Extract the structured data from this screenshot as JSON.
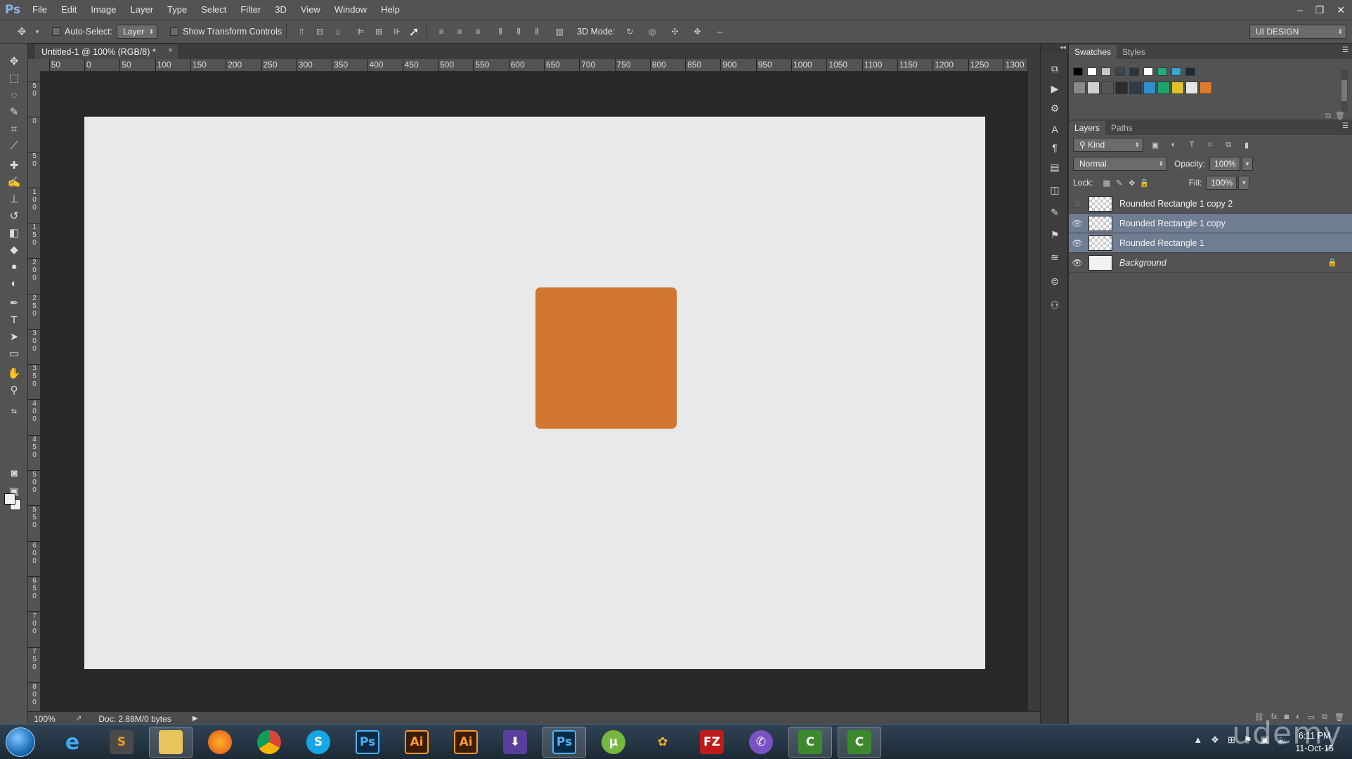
{
  "app": {
    "logo": "Ps"
  },
  "menu": [
    "File",
    "Edit",
    "Image",
    "Layer",
    "Type",
    "Select",
    "Filter",
    "3D",
    "View",
    "Window",
    "Help"
  ],
  "window_controls": {
    "minimize": "–",
    "restore": "❐",
    "close": "✕"
  },
  "options": {
    "auto_select_label": "Auto-Select:",
    "auto_select_value": "Layer",
    "show_transform_label": "Show Transform Controls",
    "mode_3d_label": "3D Mode:",
    "workspace": "UI DESIGN"
  },
  "document": {
    "tab_title": "Untitled-1 @ 100% (RGB/8) *",
    "close": "×"
  },
  "ruler": {
    "top_ticks": [
      "50",
      "0",
      "50",
      "100",
      "150",
      "200",
      "250",
      "300",
      "350",
      "400",
      "450",
      "500",
      "550",
      "600",
      "650",
      "700",
      "750",
      "800",
      "850",
      "900",
      "950",
      "1000",
      "1050",
      "1100",
      "1150",
      "1200",
      "1250",
      "1300"
    ],
    "left_ticks": [
      "5 0",
      "0",
      "5 0",
      "1 0 0",
      "1 5 0",
      "2 0 0",
      "2 5 0",
      "3 0 0",
      "3 5 0",
      "4 0 0",
      "4 5 0",
      "5 0 0",
      "5 5 0",
      "6 0 0",
      "6 5 0",
      "7 0 0",
      "7 5 0",
      "8 0 0"
    ]
  },
  "canvas": {
    "shape_color": "#d27731",
    "artboard_color": "#e9e9e9"
  },
  "status": {
    "zoom": "100%",
    "doc": "Doc: 2.88M/0 bytes"
  },
  "swatches_panel": {
    "tabs": [
      "Swatches",
      "Styles"
    ],
    "colors": [
      "#000000",
      "#ffffff",
      "#c8c8c8",
      "#3b4650",
      "#2b3440",
      "#ffffff",
      "#1fb07a",
      "#3aa4d6",
      "#1e2a36",
      "#8a8a8a",
      "#d0d0d0",
      "#555555",
      "#2c2c2c",
      "#2f3b48",
      "#2e8fd0",
      "#1aa56b",
      "#e0c22a",
      "#e6e6e6",
      "#e07a2e"
    ]
  },
  "layers_panel": {
    "tabs": [
      "Layers",
      "Paths"
    ],
    "kind_label": "Kind",
    "blend_mode": "Normal",
    "opacity_label": "Opacity:",
    "opacity_value": "100%",
    "lock_label": "Lock:",
    "fill_label": "Fill:",
    "fill_value": "100%",
    "layers": [
      {
        "name": "Rounded Rectangle 1 copy 2",
        "visible": false,
        "selected": false
      },
      {
        "name": "Rounded Rectangle 1 copy",
        "visible": true,
        "selected": true
      },
      {
        "name": "Rounded Rectangle 1",
        "visible": true,
        "selected": true
      },
      {
        "name": "Background",
        "visible": true,
        "selected": false,
        "locked": true
      }
    ]
  },
  "taskbar": {
    "apps": [
      "internet-explorer",
      "sublime-text",
      "file-explorer",
      "firefox",
      "chrome",
      "skype",
      "photoshop",
      "illustrator",
      "illustrator",
      "downloader",
      "photoshop",
      "utorrent",
      "lotus",
      "filezilla",
      "viber",
      "camtasia",
      "camtasia"
    ],
    "clock_time": "6:11 PM",
    "clock_date": "11-Oct-15"
  },
  "watermark": "udemy"
}
